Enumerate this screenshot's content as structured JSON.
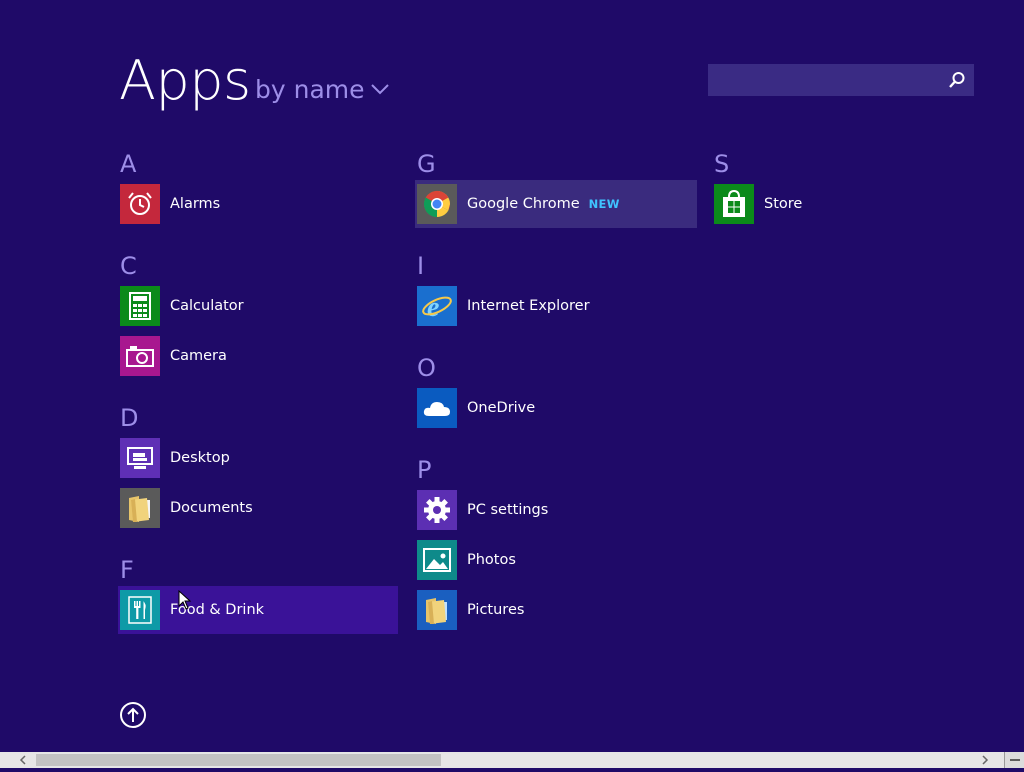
{
  "header": {
    "title": "Apps",
    "sort_label": "by name"
  },
  "search": {
    "value": "",
    "placeholder": ""
  },
  "columns": [
    {
      "groups": [
        {
          "letter": "A",
          "apps": [
            {
              "label": "Alarms",
              "icon": "alarm-clock-icon",
              "color": "#c4283c"
            }
          ]
        },
        {
          "letter": "C",
          "apps": [
            {
              "label": "Calculator",
              "icon": "calculator-icon",
              "color": "#0b8a1a"
            },
            {
              "label": "Camera",
              "icon": "camera-icon",
              "color": "#a8178f"
            }
          ]
        },
        {
          "letter": "D",
          "apps": [
            {
              "label": "Desktop",
              "icon": "desktop-icon",
              "color": "#5f2fb5"
            },
            {
              "label": "Documents",
              "icon": "documents-folder-icon",
              "color": "#5a5a5a"
            }
          ]
        },
        {
          "letter": "F",
          "apps": [
            {
              "label": "Food & Drink",
              "icon": "fork-knife-icon",
              "color": "#0e9aa7",
              "state": "hover"
            }
          ]
        }
      ]
    },
    {
      "groups": [
        {
          "letter": "G",
          "apps": [
            {
              "label": "Google Chrome",
              "icon": "chrome-icon",
              "color": "#5a5a5a",
              "badge": "NEW",
              "state": "selected"
            }
          ]
        },
        {
          "letter": "I",
          "apps": [
            {
              "label": "Internet Explorer",
              "icon": "internet-explorer-icon",
              "color": "#1a6fcf"
            }
          ]
        },
        {
          "letter": "O",
          "apps": [
            {
              "label": "OneDrive",
              "icon": "onedrive-cloud-icon",
              "color": "#0a5bc0"
            }
          ]
        },
        {
          "letter": "P",
          "apps": [
            {
              "label": "PC settings",
              "icon": "gear-icon",
              "color": "#5c2fb3"
            },
            {
              "label": "Photos",
              "icon": "photos-icon",
              "color": "#0e8a8a"
            },
            {
              "label": "Pictures",
              "icon": "pictures-folder-icon",
              "color": "#1a5fc0"
            }
          ]
        }
      ]
    },
    {
      "groups": [
        {
          "letter": "S",
          "apps": [
            {
              "label": "Store",
              "icon": "store-bag-icon",
              "color": "#0b8a1a"
            }
          ]
        }
      ]
    }
  ],
  "colors": {
    "background": "#1f0a68",
    "letter": "#9d8ee8",
    "badge": "#3fc3ff"
  }
}
